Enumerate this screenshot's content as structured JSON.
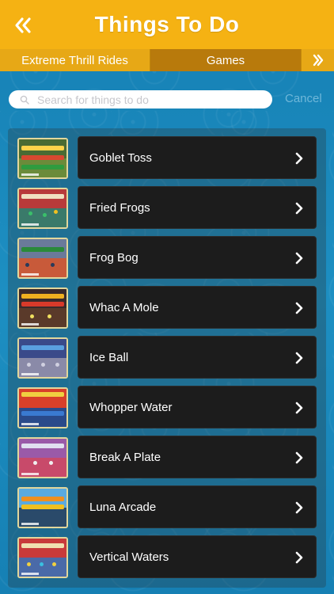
{
  "header": {
    "title": "Things To Do",
    "back_icon": "double-chevron-left-icon",
    "color": "#f5b213"
  },
  "tabs": [
    {
      "label": "Extreme Thrill Rides",
      "selected": false
    },
    {
      "label": "Games",
      "selected": true
    }
  ],
  "tabs_more_icon": "double-chevron-right-icon",
  "search": {
    "placeholder": "Search for things to do",
    "value": "",
    "cancel_label": "Cancel"
  },
  "items": [
    {
      "label": "Goblet Toss"
    },
    {
      "label": "Fried Frogs"
    },
    {
      "label": "Frog Bog"
    },
    {
      "label": "Whac A Mole"
    },
    {
      "label": "Ice Ball"
    },
    {
      "label": "Whopper Water"
    },
    {
      "label": "Break A Plate"
    },
    {
      "label": "Luna Arcade"
    },
    {
      "label": "Vertical Waters"
    }
  ]
}
